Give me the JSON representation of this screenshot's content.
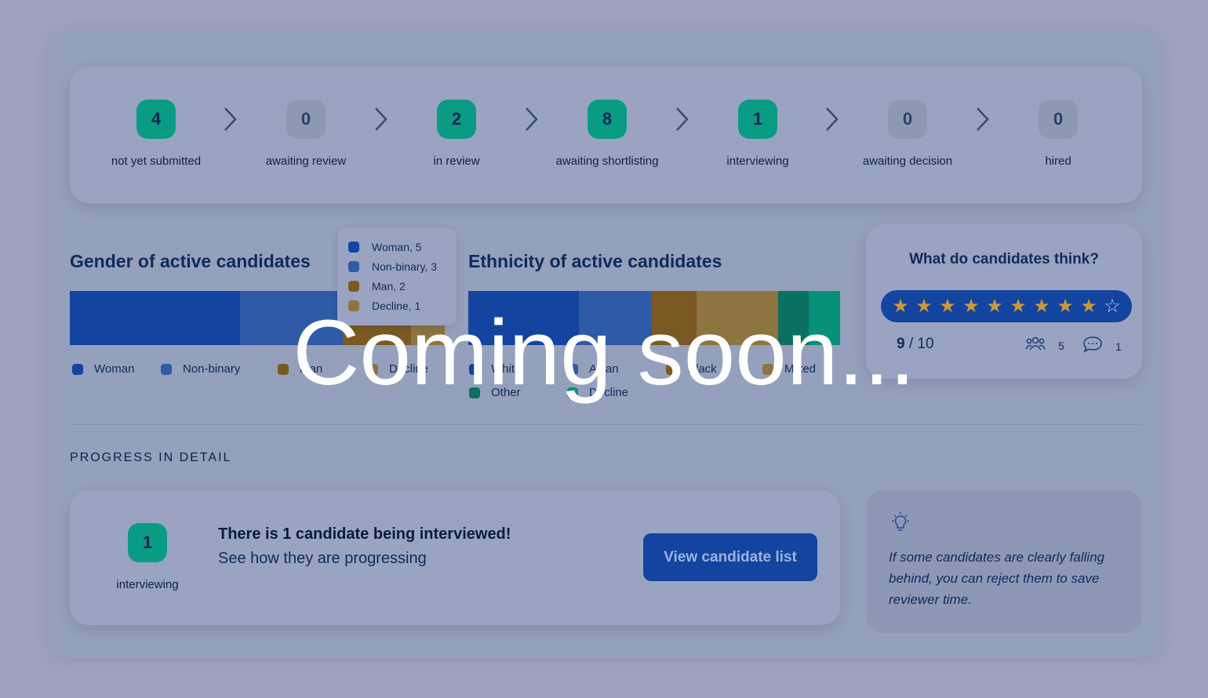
{
  "pipeline": {
    "stages": [
      {
        "count": "4",
        "label": "not yet submitted",
        "active": true
      },
      {
        "count": "0",
        "label": "awaiting review",
        "active": false
      },
      {
        "count": "2",
        "label": "in review",
        "active": true
      },
      {
        "count": "8",
        "label": "awaiting shortlisting",
        "active": true
      },
      {
        "count": "1",
        "label": "interviewing",
        "active": true
      },
      {
        "count": "0",
        "label": "awaiting decision",
        "active": false
      },
      {
        "count": "0",
        "label": "hired",
        "active": false
      }
    ]
  },
  "gender": {
    "title": "Gender of active candidates",
    "legend": [
      "Woman",
      "Non-binary",
      "Man",
      "Decline"
    ],
    "segments": [
      {
        "name": "Woman",
        "value": 5,
        "color": "#1244a0"
      },
      {
        "name": "Non-binary",
        "value": 3,
        "color": "#2e5aa8"
      },
      {
        "name": "Man",
        "value": 2,
        "color": "#7a5a22"
      },
      {
        "name": "Decline",
        "value": 1,
        "color": "#8d7440"
      }
    ],
    "tooltip": [
      "Woman, 5",
      "Non-binary, 3",
      "Man, 2",
      "Decline, 1"
    ]
  },
  "ethnicity": {
    "title": "Ethnicity of active candidates",
    "legend": [
      "White",
      "Asian",
      "Black",
      "Mixed",
      "Other",
      "Decline"
    ],
    "segments": [
      {
        "name": "White",
        "value": 5,
        "color": "#1244a0"
      },
      {
        "name": "Asian",
        "value": 3.3,
        "color": "#2e5aa8"
      },
      {
        "name": "Black",
        "value": 2,
        "color": "#7a5a22"
      },
      {
        "name": "Mixed",
        "value": 3.7,
        "color": "#8d7440"
      },
      {
        "name": "Other",
        "value": 1.4,
        "color": "#0a7060"
      },
      {
        "name": "Decline",
        "value": 1.4,
        "color": "#07917a"
      }
    ]
  },
  "feedback": {
    "title": "What do candidates think?",
    "rating": 9,
    "max": 10,
    "score": "9",
    "score_max": "/ 10",
    "respondents": "5",
    "comments": "1"
  },
  "progress": {
    "section_title": "PROGRESS IN DETAIL",
    "count": "1",
    "stage_label": "interviewing",
    "headline": "There is 1 candidate being interviewed!",
    "subline": "See how they are progressing",
    "button": "View candidate list"
  },
  "tip": {
    "text": "If some candidates are clearly falling behind, you can reject them to save reviewer time."
  },
  "overlay": {
    "text": "Coming soon..."
  },
  "colors": {
    "teal": "#0a9b84",
    "navy": "#1244a0",
    "gold": "#c99a3a"
  }
}
